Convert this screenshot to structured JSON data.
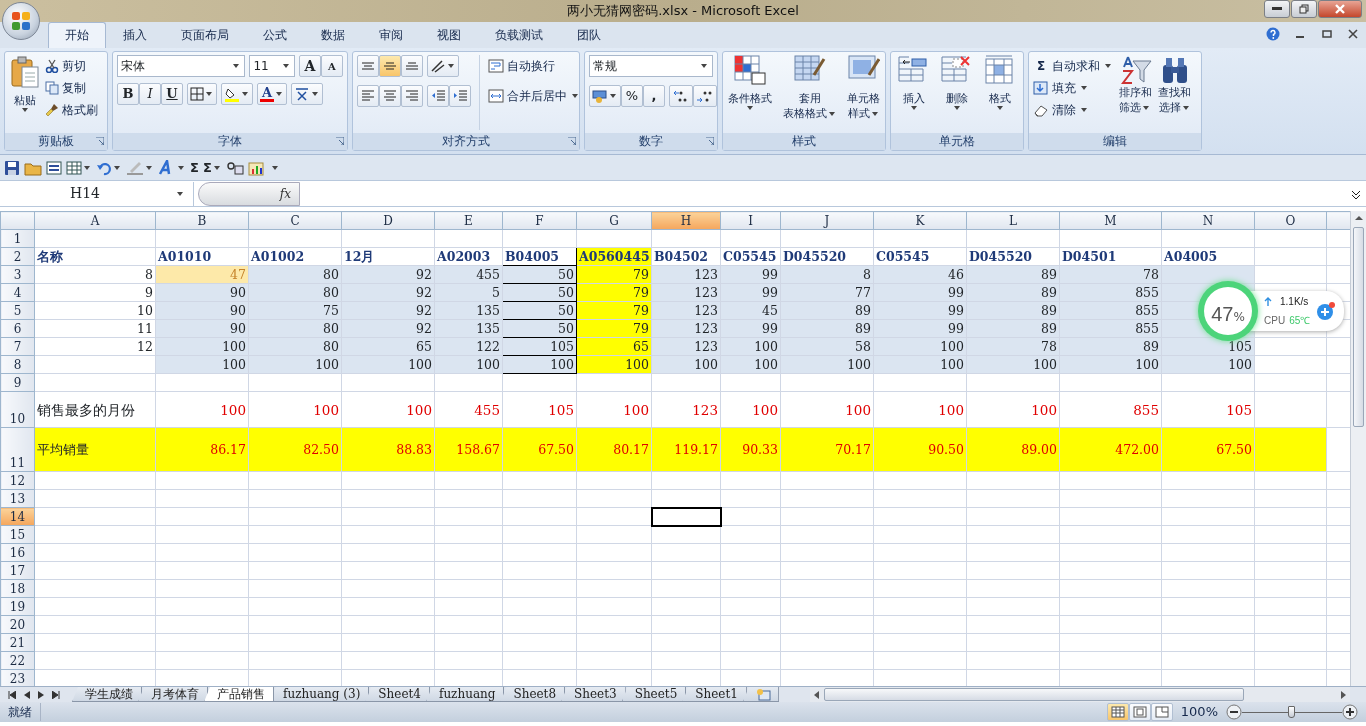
{
  "window": {
    "title": "两小无猜网密码.xlsx - Microsoft Excel"
  },
  "ribbon_tabs": [
    {
      "label": "开始",
      "selected": true
    },
    {
      "label": "插入",
      "selected": false
    },
    {
      "label": "页面布局",
      "selected": false
    },
    {
      "label": "公式",
      "selected": false
    },
    {
      "label": "数据",
      "selected": false
    },
    {
      "label": "审阅",
      "selected": false
    },
    {
      "label": "视图",
      "selected": false
    },
    {
      "label": "负载测试",
      "selected": false
    },
    {
      "label": "团队",
      "selected": false
    }
  ],
  "clipboard": {
    "title": "剪贴板",
    "paste": "粘贴",
    "cut": "剪切",
    "copy": "复制",
    "format_painter": "格式刷"
  },
  "font": {
    "title": "字体",
    "name": "宋体",
    "size": "11",
    "grow": "A",
    "shrink": "A",
    "bold": "B",
    "italic": "I",
    "underline": "U",
    "font_color": "A"
  },
  "alignment": {
    "title": "对齐方式",
    "wrap_text": "自动换行",
    "merge_center": "合并后居中"
  },
  "number": {
    "title": "数字",
    "format": "常规",
    "percent": "%",
    "comma": ","
  },
  "styles": {
    "title": "样式",
    "conditional": "条件格式",
    "table_format": [
      "套用",
      "表格格式"
    ],
    "cell_styles": [
      "单元格",
      "样式"
    ]
  },
  "cells": {
    "title": "单元格",
    "insert": "插入",
    "delete": "删除",
    "format": "格式"
  },
  "editing": {
    "title": "编辑",
    "sigma": "Σ",
    "autosum": "自动求和",
    "fill": "填充",
    "clear": "清除",
    "sort": [
      "排序和",
      "筛选"
    ],
    "find": [
      "查找和",
      "选择"
    ]
  },
  "quick_access": {
    "sum_1": "Σ",
    "sum_2": "Σ"
  },
  "formula_bar": {
    "name_box": "H14",
    "fx": "fx"
  },
  "columns": [
    {
      "label": "A",
      "selected": false,
      "kind": "plain"
    },
    {
      "label": "B",
      "selected": false,
      "kind": "plain"
    },
    {
      "label": "C",
      "selected": false,
      "kind": "plain"
    },
    {
      "label": "D",
      "selected": false,
      "kind": "plain"
    },
    {
      "label": "E",
      "selected": false,
      "kind": "plain"
    },
    {
      "label": "F",
      "selected": false,
      "kind": "boxed"
    },
    {
      "label": "G",
      "selected": false,
      "kind": "highlight"
    },
    {
      "label": "H",
      "selected": true,
      "kind": "plain"
    },
    {
      "label": "I",
      "selected": false,
      "kind": "plain"
    },
    {
      "label": "J",
      "selected": false,
      "kind": "plain"
    },
    {
      "label": "K",
      "selected": false,
      "kind": "plain"
    },
    {
      "label": "L",
      "selected": false,
      "kind": "plain"
    },
    {
      "label": "M",
      "selected": false,
      "kind": "plain"
    },
    {
      "label": "N",
      "selected": false,
      "kind": "plain"
    },
    {
      "label": "O",
      "selected": false,
      "kind": "plain"
    }
  ],
  "rows": [
    {
      "num": "1",
      "selected": false,
      "kind": "blank",
      "cells": []
    },
    {
      "num": "2",
      "selected": false,
      "kind": "header",
      "cells": [
        "名称",
        "A01010",
        "A01002",
        "12月",
        "A02003",
        "B04005",
        "A0560445",
        "B04502",
        "C05545",
        "D045520",
        "C05545",
        "D045520",
        "D04501",
        "A04005"
      ]
    },
    {
      "num": "3",
      "selected": false,
      "kind": "data",
      "first_value_highlighted": true,
      "cells": [
        "8",
        "47",
        "80",
        "92",
        "455",
        "50",
        "79",
        "123",
        "99",
        "8",
        "46",
        "89",
        "78",
        ""
      ]
    },
    {
      "num": "4",
      "selected": false,
      "kind": "data",
      "cells": [
        "9",
        "90",
        "80",
        "92",
        "5",
        "50",
        "79",
        "123",
        "99",
        "77",
        "99",
        "89",
        "855",
        ""
      ]
    },
    {
      "num": "5",
      "selected": false,
      "kind": "data",
      "cells": [
        "10",
        "90",
        "75",
        "92",
        "135",
        "50",
        "79",
        "123",
        "45",
        "89",
        "99",
        "89",
        "855",
        ""
      ]
    },
    {
      "num": "6",
      "selected": false,
      "kind": "data",
      "cells": [
        "11",
        "90",
        "80",
        "92",
        "135",
        "50",
        "79",
        "123",
        "99",
        "89",
        "99",
        "89",
        "855",
        ""
      ]
    },
    {
      "num": "7",
      "selected": false,
      "kind": "data",
      "cells": [
        "12",
        "100",
        "80",
        "65",
        "122",
        "105",
        "65",
        "123",
        "100",
        "58",
        "100",
        "78",
        "89",
        "105"
      ]
    },
    {
      "num": "8",
      "selected": false,
      "kind": "data",
      "cells": [
        "",
        "100",
        "100",
        "100",
        "100",
        "100",
        "100",
        "100",
        "100",
        "100",
        "100",
        "100",
        "100",
        "100"
      ]
    },
    {
      "num": "9",
      "selected": false,
      "kind": "blank",
      "cells": []
    },
    {
      "num": "10",
      "selected": false,
      "kind": "max",
      "cells": [
        "销售最多的月份",
        "100",
        "100",
        "100",
        "455",
        "105",
        "100",
        "123",
        "100",
        "100",
        "100",
        "100",
        "855",
        "105"
      ]
    },
    {
      "num": "11",
      "selected": false,
      "kind": "average",
      "cells": [
        "平均销量",
        "86.17",
        "82.50",
        "88.83",
        "158.67",
        "67.50",
        "80.17",
        "119.17",
        "90.33",
        "70.17",
        "90.50",
        "89.00",
        "472.00",
        "67.50"
      ]
    },
    {
      "num": "12",
      "selected": false,
      "kind": "blank",
      "cells": []
    },
    {
      "num": "13",
      "selected": false,
      "kind": "blank",
      "cells": []
    },
    {
      "num": "14",
      "selected": true,
      "kind": "blank",
      "cells": []
    },
    {
      "num": "15",
      "selected": false,
      "kind": "blank",
      "cells": []
    },
    {
      "num": "16",
      "selected": false,
      "kind": "blank",
      "cells": []
    },
    {
      "num": "17",
      "selected": false,
      "kind": "blank",
      "cells": []
    },
    {
      "num": "18",
      "selected": false,
      "kind": "blank",
      "cells": []
    },
    {
      "num": "19",
      "selected": false,
      "kind": "blank",
      "cells": []
    },
    {
      "num": "20",
      "selected": false,
      "kind": "blank",
      "cells": []
    },
    {
      "num": "21",
      "selected": false,
      "kind": "blank",
      "cells": []
    },
    {
      "num": "22",
      "selected": false,
      "kind": "blank",
      "cells": []
    },
    {
      "num": "23",
      "selected": false,
      "kind": "blank",
      "cells": []
    }
  ],
  "sheet_tabs": [
    {
      "label": "学生成绩",
      "selected": false
    },
    {
      "label": "月考体育",
      "selected": false
    },
    {
      "label": "产品销售",
      "selected": true
    },
    {
      "label": "fuzhuang (3)",
      "selected": false
    },
    {
      "label": "Sheet4",
      "selected": false
    },
    {
      "label": "fuzhuang",
      "selected": false
    },
    {
      "label": "Sheet8",
      "selected": false
    },
    {
      "label": "Sheet3",
      "selected": false
    },
    {
      "label": "Sheet5",
      "selected": false
    },
    {
      "label": "Sheet1",
      "selected": false
    }
  ],
  "status_bar": {
    "text": "就绪",
    "zoom": "100%",
    "zoom_slider": {
      "level": 0.5
    }
  },
  "monitor_widget": {
    "percent": "47",
    "unit": "%",
    "speed": "1.1K/s",
    "cpu_label": "CPU",
    "temperature": "65℃"
  }
}
